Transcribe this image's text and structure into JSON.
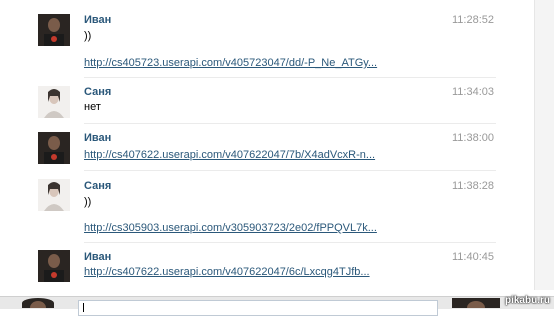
{
  "messages": [
    {
      "sender": "Иван",
      "time": "11:28:52",
      "text": "))",
      "link": "http://cs405723.userapi.com/v405723047/dd/-P_Ne_ATGy..."
    },
    {
      "sender": "Саня",
      "time": "11:34:03",
      "text": "нет",
      "link": ""
    },
    {
      "sender": "Иван",
      "time": "11:38:00",
      "text": "",
      "link": "http://cs407622.userapi.com/v407622047/7b/X4adVcxR-n..."
    },
    {
      "sender": "Саня",
      "time": "11:38:28",
      "text": "))",
      "link": "http://cs305903.userapi.com/v305903723/2e02/fPPQVL7k..."
    },
    {
      "sender": "Иван",
      "time": "11:40:45",
      "text": "",
      "link": "http://cs407622.userapi.com/v407622047/6c/Lxcqg4TJfb..."
    }
  ],
  "watermark": "pikabu.ru",
  "colors": {
    "name": "#2b587a",
    "link": "#2b587a",
    "time": "#999999"
  },
  "icons": {
    "ivan_avatar": "ivan-avatar",
    "sanya_avatar": "sanya-avatar"
  }
}
